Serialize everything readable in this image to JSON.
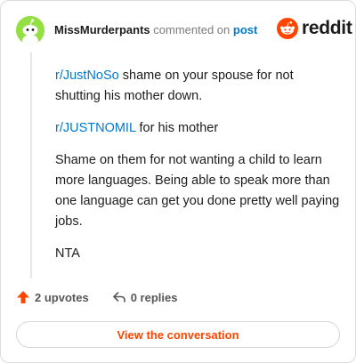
{
  "comment": {
    "username": "MissMurderpants",
    "action_text": "commented on",
    "post_link": "post",
    "brand": "reddit",
    "paragraphs": [
      {
        "link": "r/JustNoSo",
        "text": " shame on your spouse for not shutting his mother down."
      },
      {
        "link": "r/JUSTNOMIL",
        "text": " for his mother"
      },
      {
        "link": "",
        "text": "Shame on them for not wanting a child to learn more languages. Being able to speak more than one language can get you done pretty well paying jobs."
      },
      {
        "link": "",
        "text": "NTA"
      }
    ],
    "upvotes": "2 upvotes",
    "replies": "0 replies",
    "view_button": "View the conversation"
  },
  "colors": {
    "accent": "#ff4500",
    "link": "#0079d3",
    "avatar_bg": "#94e044"
  },
  "icons": {
    "avatar": "snoo-avatar-icon",
    "logo": "reddit-logo-icon",
    "upvote": "upvote-arrow-icon",
    "reply": "reply-arrow-icon"
  }
}
